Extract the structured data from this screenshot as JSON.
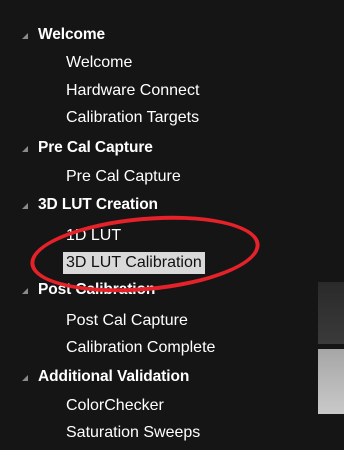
{
  "sections": [
    {
      "title": "Welcome",
      "items": [
        "Welcome",
        "Hardware Connect",
        "Calibration Targets"
      ]
    },
    {
      "title": "Pre Cal Capture",
      "items": [
        "Pre Cal Capture"
      ]
    },
    {
      "title": "3D LUT Creation",
      "items": [
        "1D LUT",
        "3D LUT Calibration"
      ]
    },
    {
      "title": "Post Calibration",
      "items": [
        "Post Cal Capture",
        "Calibration Complete"
      ]
    },
    {
      "title": "Additional Validation",
      "items": [
        "ColorChecker",
        "Saturation Sweeps"
      ]
    }
  ],
  "selected_item": "3D LUT Calibration",
  "colors": {
    "background": "#151515",
    "text": "#ffffff",
    "selected_bg": "#d9d9d9",
    "annotation": "#e52229"
  },
  "icons": {
    "expander": "caret-icon"
  }
}
